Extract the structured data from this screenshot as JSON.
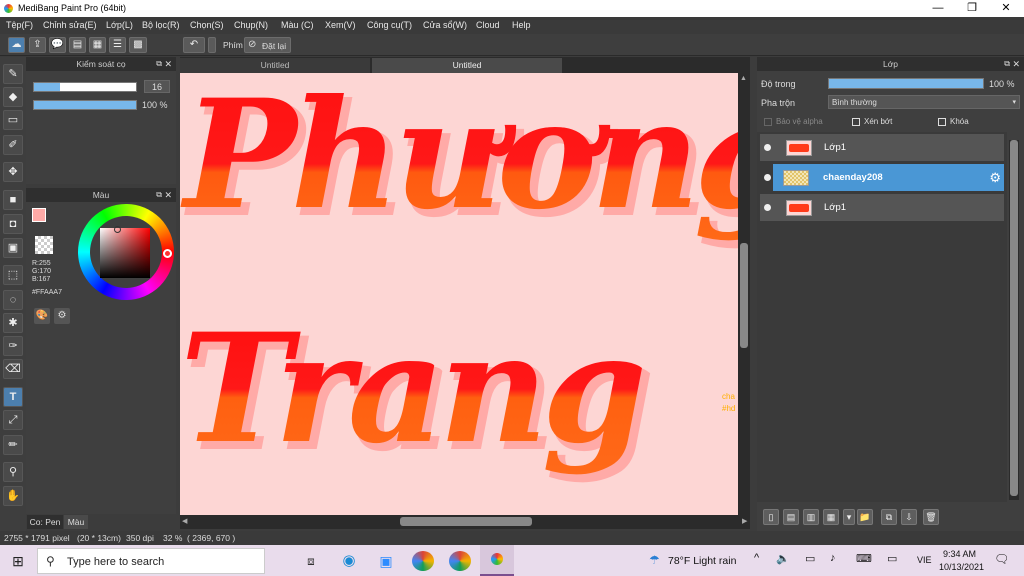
{
  "window": {
    "title": "MediBang Paint Pro (64bit)",
    "minimize": "—",
    "maximize": "❐",
    "close": "✕"
  },
  "menu": [
    "Tệp(F)",
    "Chỉnh sửa(E)",
    "Lớp(L)",
    "Bộ lọc(R)",
    "Chọn(S)",
    "Chụp(N)",
    "Màu (C)",
    "Xem(V)",
    "Công cụ(T)",
    "Cửa sổ(W)",
    "Cloud",
    "Help"
  ],
  "toolbar": {
    "keys_label": "Phím",
    "reset_label": "Đặt lại"
  },
  "brush_panel": {
    "title": "Kiểm soát cọ",
    "size_value": "16",
    "opacity_value": "100 %",
    "size_fill": 0.25,
    "opacity_fill": 1.0
  },
  "color_panel": {
    "title": "Màu",
    "r": "R:255",
    "g": "G:170",
    "b": "B:167",
    "hex": "#FFAAA7",
    "main_color": "#FFAAA7"
  },
  "left_tabs": {
    "brush": "Co: Pen",
    "color": "Màu"
  },
  "canvas": {
    "tabs": [
      "Untitled",
      "Untitled"
    ],
    "line1": "Phương",
    "line2": "Trang",
    "side_text_1": "cha",
    "side_text_2": "#hd"
  },
  "layers_panel": {
    "title": "Lớp",
    "opacity_label": "Độ trong",
    "opacity_value": "100 %",
    "opacity_fill": 1.0,
    "blend_label": "Pha trộn",
    "blend_value": "Bình thường",
    "protect_alpha": "Bảo vệ alpha",
    "clipping": "Xén bớt",
    "lock": "Khóa",
    "layers": [
      {
        "name": "Lớp1",
        "selected": false
      },
      {
        "name": "chaenday208",
        "selected": true
      },
      {
        "name": "Lớp1",
        "selected": false
      }
    ]
  },
  "status": {
    "size": "2755 * 1791 pixel",
    "cm": "(20 * 13cm)",
    "dpi": "350 dpi",
    "zoom": "32 %",
    "coords": "( 2369, 670 )"
  },
  "taskbar": {
    "search_placeholder": "Type here to search",
    "weather": "78°F  Light rain",
    "lang": "VIE",
    "time": "9:34 AM",
    "date": "10/13/2021"
  }
}
